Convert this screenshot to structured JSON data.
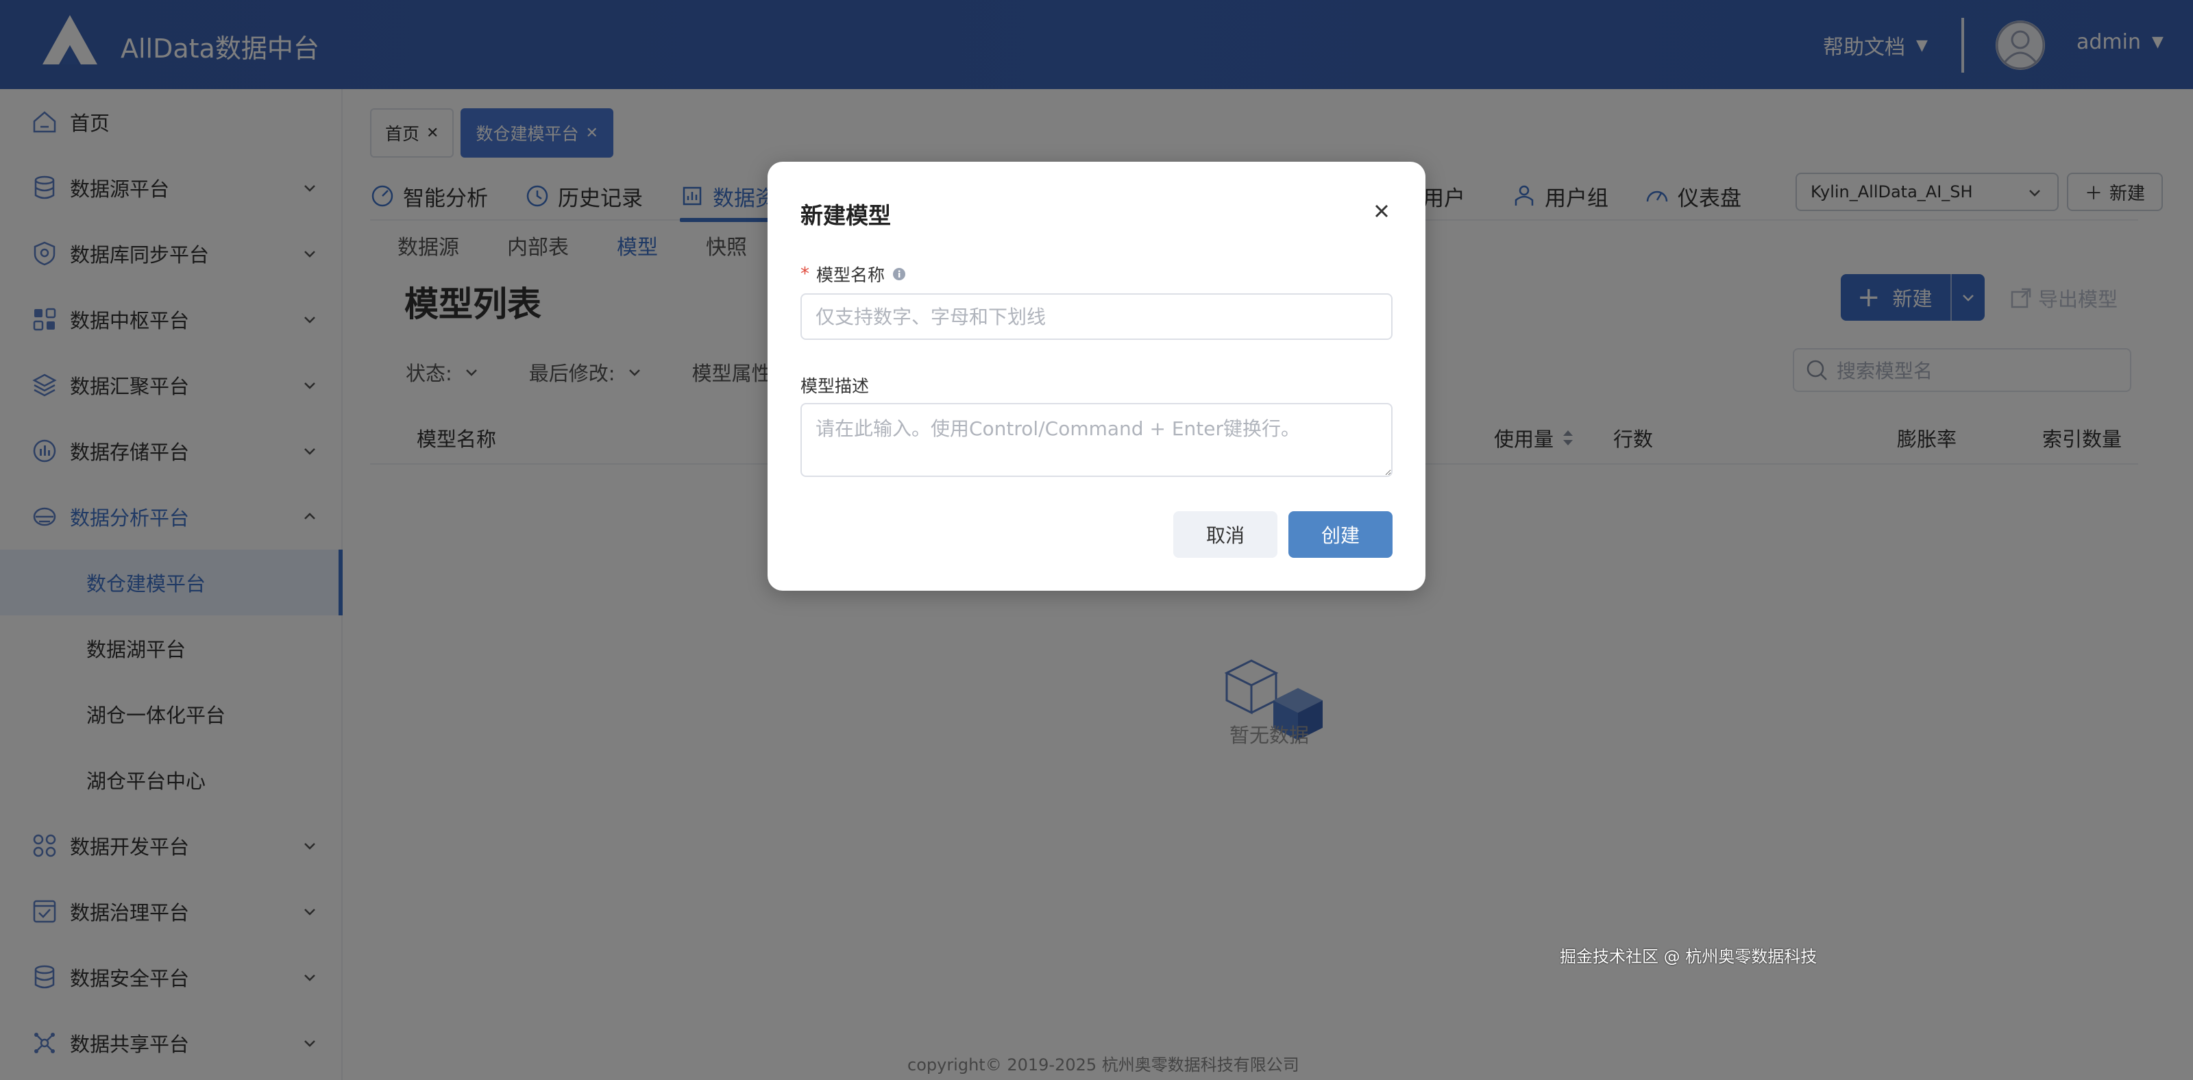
{
  "header": {
    "app_title": "AllData数据中台",
    "help_label": "帮助文档",
    "user_name": "admin"
  },
  "sidebar": {
    "items": [
      {
        "label": "首页",
        "icon": "home-icon"
      },
      {
        "label": "数据源平台",
        "icon": "database-icon"
      },
      {
        "label": "数据库同步平台",
        "icon": "sync-shield-icon"
      },
      {
        "label": "数据中枢平台",
        "icon": "grid-icon"
      },
      {
        "label": "数据汇聚平台",
        "icon": "layers-icon"
      },
      {
        "label": "数据存储平台",
        "icon": "bar-chart-icon"
      },
      {
        "label": "数据分析平台",
        "icon": "analysis-icon"
      },
      {
        "label": "数仓建模平台"
      },
      {
        "label": "数据湖平台"
      },
      {
        "label": "湖仓一体化平台"
      },
      {
        "label": "湖仓平台中心"
      },
      {
        "label": "数据开发平台",
        "icon": "apps-icon"
      },
      {
        "label": "数据治理平台",
        "icon": "checklist-icon"
      },
      {
        "label": "数据安全平台",
        "icon": "database-icon"
      },
      {
        "label": "数据共享平台",
        "icon": "share-icon"
      }
    ]
  },
  "page_tabs": [
    {
      "label": "首页"
    },
    {
      "label": "数仓建模平台"
    }
  ],
  "top_nav": [
    {
      "label": "智能分析"
    },
    {
      "label": "历史记录"
    },
    {
      "label": "数据资"
    },
    {
      "label": "用户"
    },
    {
      "label": "用户组"
    },
    {
      "label": "仪表盘"
    }
  ],
  "project_select": "Kylin_AllData_AI_SH",
  "top_new_label": "新建",
  "sub_tabs": [
    "数据源",
    "内部表",
    "模型",
    "快照"
  ],
  "page_heading": "模型列表",
  "new_model_label": "新建",
  "export_label": "导出模型",
  "filters": [
    "状态:",
    "最后修改:",
    "模型属性"
  ],
  "search_placeholder": "搜索模型名",
  "table_headers": [
    "模型名称",
    "使用量",
    "行数",
    "膨胀率",
    "索引数量"
  ],
  "empty_text": "暂无数据",
  "copyright": "copyright© 2019-2025 杭州奥零数据科技有限公司",
  "watermark": "掘金技术社区 @ 杭州奥零数据科技",
  "modal": {
    "title": "新建模型",
    "name_label": "模型名称",
    "name_placeholder": "仅支持数字、字母和下划线",
    "desc_label": "模型描述",
    "desc_placeholder": "请在此输入。使用Control/Command + Enter键换行。",
    "cancel_label": "取消",
    "create_label": "创建"
  },
  "colors": {
    "header_bg": "#3d66b8",
    "accent": "#3f72c9",
    "create_btn": "#4f86c6"
  }
}
